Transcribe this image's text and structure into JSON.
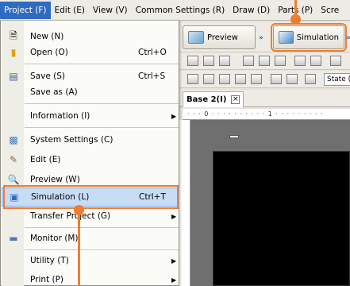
{
  "menubar": {
    "items": [
      "Project (F)",
      "Edit (E)",
      "View (V)",
      "Common Settings (R)",
      "Draw (D)",
      "Parts (P)",
      "Scre"
    ]
  },
  "toolbar": {
    "preview_label": "Preview",
    "simulation_label": "Simulation",
    "state_value": "State ("
  },
  "tab": {
    "label": "Base 2(I)",
    "close": "×"
  },
  "ruler": {
    "text": "· · · 0 · · · · · · · · · · 1 · · · · · · · · ·"
  },
  "menu": {
    "items": [
      {
        "label": "New (N)",
        "shortcut": "",
        "icon": "new-file-icon"
      },
      {
        "label": "Open (O)",
        "shortcut": "Ctrl+O",
        "icon": "folder-icon"
      },
      {
        "label": "Save (S)",
        "shortcut": "Ctrl+S",
        "icon": "save-icon"
      },
      {
        "label": "Save as (A)",
        "shortcut": "",
        "icon": ""
      },
      {
        "label": "Information (I)",
        "shortcut": "",
        "icon": "",
        "submenu": "▶"
      },
      {
        "label": "System Settings (C)",
        "shortcut": "",
        "icon": "system-settings-icon"
      },
      {
        "label": "Edit (E)",
        "shortcut": "",
        "icon": "edit-icon"
      },
      {
        "label": "Preview (W)",
        "shortcut": "",
        "icon": "preview-icon"
      },
      {
        "label": "Simulation (L)",
        "shortcut": "Ctrl+T",
        "icon": "simulation-icon"
      },
      {
        "label": "Transfer Project (G)",
        "shortcut": "",
        "icon": "",
        "submenu": "▶"
      },
      {
        "label": "Monitor (M)",
        "shortcut": "",
        "icon": "monitor-icon"
      },
      {
        "label": "Utility (T)",
        "shortcut": "",
        "icon": "",
        "submenu": "▶"
      },
      {
        "label": "Print (P)",
        "shortcut": "",
        "icon": "",
        "submenu": "▶"
      }
    ]
  },
  "colors": {
    "accent": "#ee7d2f",
    "menu_highlight": "#c9dcf6",
    "menubar_active": "#2f6bc0"
  }
}
